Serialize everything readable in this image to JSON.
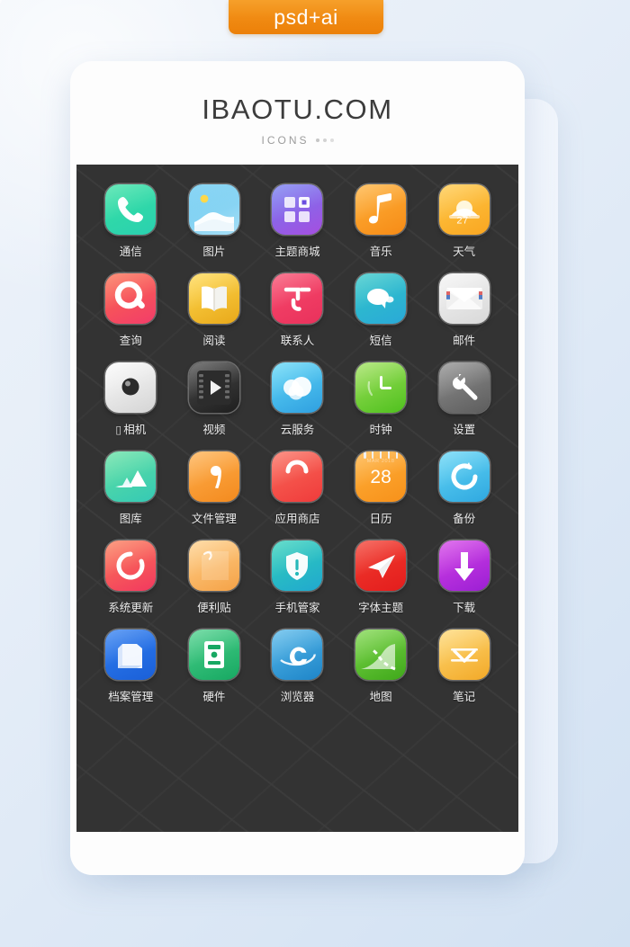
{
  "ribbon": {
    "label": "psd+ai",
    "color": "#f08a12"
  },
  "brand": {
    "title": "IBAOTU.COM",
    "subtitle": "ICONS"
  },
  "panel": {
    "background": "#333333"
  },
  "grid": {
    "rows": 6,
    "columns": 5,
    "icons": [
      {
        "label": "通信",
        "icon": "phone-icon",
        "colors": [
          "#35e0a1",
          "#2ad0b0"
        ]
      },
      {
        "label": "图片",
        "icon": "picture-icon",
        "colors": [
          "#5ec6f0",
          "#a8dff6"
        ]
      },
      {
        "label": "主题商城",
        "icon": "theme-store-icon",
        "colors": [
          "#6f7bf0",
          "#a64ee0"
        ]
      },
      {
        "label": "音乐",
        "icon": "music-note-icon",
        "colors": [
          "#ffb13a",
          "#f68b16"
        ]
      },
      {
        "label": "天气",
        "icon": "weather-sun-icon",
        "colors": [
          "#ffc845",
          "#f9a621"
        ],
        "badge": "27",
        "badge_unit": "°"
      },
      {
        "label": "查询",
        "icon": "search-icon",
        "colors": [
          "#fb6a4a",
          "#f23c6a"
        ]
      },
      {
        "label": "阅读",
        "icon": "book-icon",
        "colors": [
          "#ffd84d",
          "#e8a81a"
        ]
      },
      {
        "label": "联系人",
        "icon": "contacts-icon",
        "colors": [
          "#f7496b",
          "#e9315c"
        ]
      },
      {
        "label": "短信",
        "icon": "message-icon",
        "colors": [
          "#2fc6c6",
          "#2aa9d8"
        ]
      },
      {
        "label": "邮件",
        "icon": "mail-icon",
        "colors": [
          "#f4f4f4",
          "#d8d8d8"
        ]
      },
      {
        "label": "相机",
        "icon": "camera-icon",
        "colors": [
          "#fbfbfb",
          "#d4d4d4"
        ],
        "prefix": "▯"
      },
      {
        "label": "视频",
        "icon": "video-film-icon",
        "colors": [
          "#4a4a4a",
          "#1e1e1e"
        ]
      },
      {
        "label": "云服务",
        "icon": "cloud-icon",
        "colors": [
          "#5fd7f7",
          "#2f9fe0"
        ]
      },
      {
        "label": "时钟",
        "icon": "clock-icon",
        "colors": [
          "#9ee05a",
          "#4fc01e"
        ]
      },
      {
        "label": "设置",
        "icon": "wrench-icon",
        "colors": [
          "#8e8e8e",
          "#5d5d5d"
        ]
      },
      {
        "label": "图库",
        "icon": "gallery-icon",
        "colors": [
          "#5fe0a0",
          "#35c9b5"
        ]
      },
      {
        "label": "文件管理",
        "icon": "file-manager-icon",
        "colors": [
          "#ffaf4d",
          "#f38a1e"
        ]
      },
      {
        "label": "应用商店",
        "icon": "app-store-icon",
        "colors": [
          "#fa6a5a",
          "#ef3b3b"
        ]
      },
      {
        "label": "日历",
        "icon": "calendar-icon",
        "colors": [
          "#ffb03a",
          "#f7911a"
        ],
        "day": "28",
        "month": "MAR 2018"
      },
      {
        "label": "备份",
        "icon": "backup-icon",
        "colors": [
          "#63d5f5",
          "#2fa8e0"
        ]
      },
      {
        "label": "系统更新",
        "icon": "system-update-icon",
        "colors": [
          "#fb7a55",
          "#f2385f"
        ]
      },
      {
        "label": "便利贴",
        "icon": "sticky-note-icon",
        "colors": [
          "#ffd08a",
          "#f5a247"
        ]
      },
      {
        "label": "手机管家",
        "icon": "shield-icon",
        "colors": [
          "#2fd0b8",
          "#21a8cf"
        ]
      },
      {
        "label": "字体主题",
        "icon": "paper-plane-icon",
        "colors": [
          "#f23b2e",
          "#e31d1d"
        ]
      },
      {
        "label": "下载",
        "icon": "download-icon",
        "colors": [
          "#d441e6",
          "#9b1fd4"
        ]
      },
      {
        "label": "档案管理",
        "icon": "archive-icon",
        "colors": [
          "#2f7ef0",
          "#1a5fd8"
        ]
      },
      {
        "label": "硬件",
        "icon": "hardware-icon",
        "colors": [
          "#4ad08a",
          "#17a862"
        ]
      },
      {
        "label": "浏览器",
        "icon": "browser-icon",
        "colors": [
          "#55b8ea",
          "#1e85c8"
        ]
      },
      {
        "label": "地图",
        "icon": "map-icon",
        "colors": [
          "#7cd64a",
          "#3fa81a"
        ]
      },
      {
        "label": "笔记",
        "icon": "notes-icon",
        "colors": [
          "#ffd873",
          "#f2a928"
        ]
      }
    ]
  }
}
